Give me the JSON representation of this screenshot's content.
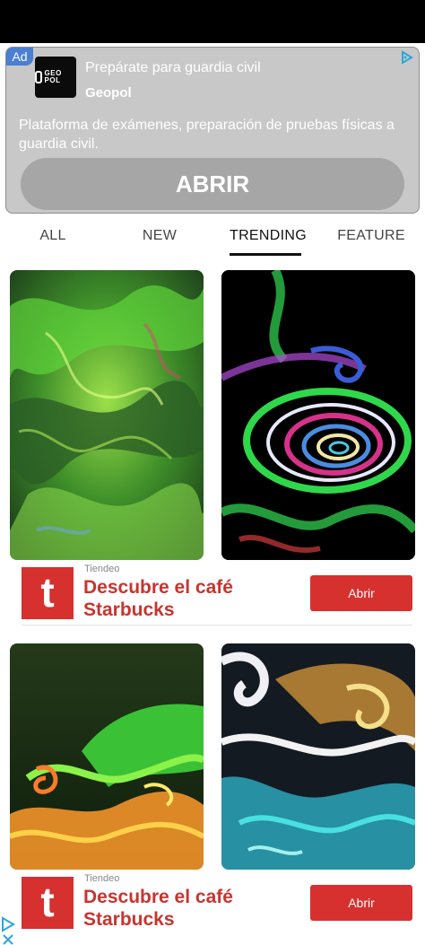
{
  "ad_banner": {
    "badge": "Ad",
    "logo_text": "GEO POL",
    "headline": "Prepárate para guardia civil",
    "advertiser": "Geopol",
    "description": "Plataforma de exámenes, preparación de pruebas físicas a guardia civil.",
    "cta": "ABRIR"
  },
  "tabs": [
    {
      "label": "ALL",
      "active": false
    },
    {
      "label": "NEW",
      "active": false
    },
    {
      "label": "TRENDING",
      "active": true
    },
    {
      "label": "FEATURE",
      "active": false
    }
  ],
  "wallpapers": [
    {
      "name": "green marble swirl"
    },
    {
      "name": "colorful spiral"
    },
    {
      "name": "green orange flow"
    },
    {
      "name": "teal yellow swirl"
    }
  ],
  "native_ads": [
    {
      "logo_letter": "t",
      "source": "Tiendeo",
      "title": "Descubre el café Starbucks",
      "cta": "Abrir"
    },
    {
      "logo_letter": "t",
      "source": "Tiendeo",
      "title": "Descubre el café Starbucks",
      "cta": "Abrir"
    }
  ],
  "colors": {
    "accent": "#d6302f",
    "ad_badge": "#4a7fd3"
  }
}
